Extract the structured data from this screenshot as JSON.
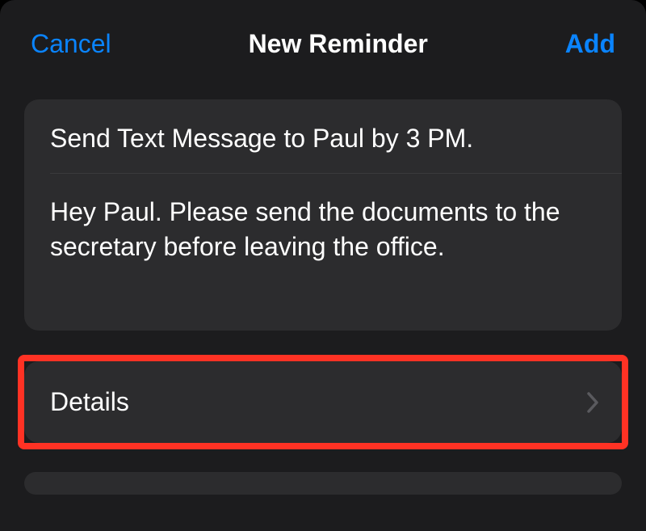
{
  "nav": {
    "cancel_label": "Cancel",
    "title": "New Reminder",
    "add_label": "Add"
  },
  "reminder": {
    "title_value": "Send Text Message to Paul by 3 PM.",
    "notes_value": "Hey Paul. Please send the documents to the secretary before leaving the office."
  },
  "details": {
    "label": "Details"
  }
}
